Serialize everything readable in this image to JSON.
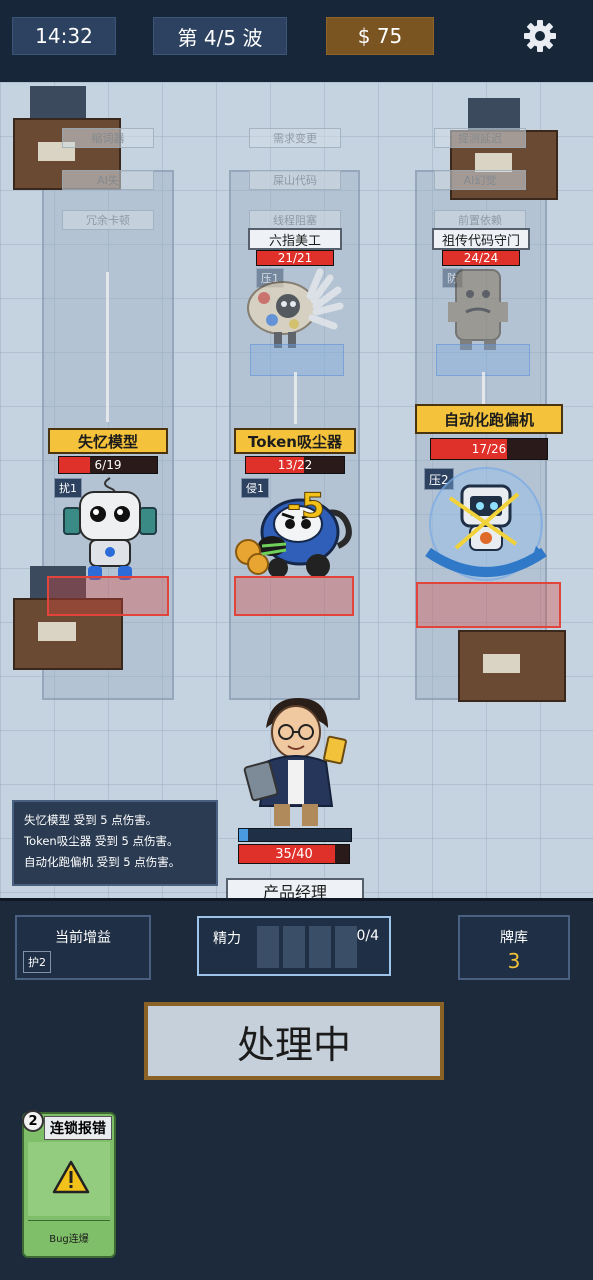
{
  "topbar": {
    "time": "14:32",
    "wave": "第 4/5 波",
    "money": "$ 75",
    "settings_icon": "gear-icon"
  },
  "field": {
    "ghost_tags": [
      "缩词器",
      "AI失",
      "冗余卡顿",
      "需求变更",
      "屎山代码",
      "线程阻塞",
      "提测延迟",
      "AI幻觉",
      "前置依赖"
    ],
    "back_enemies": [
      {
        "name": "六指美工",
        "hp": "21/21",
        "hp_current": 21,
        "hp_max": 21,
        "intent": "压1"
      },
      {
        "name": "祖传代码守门",
        "hp": "24/24",
        "hp_current": 24,
        "hp_max": 24,
        "intent": "防"
      }
    ],
    "enemies": [
      {
        "name": "失忆模型",
        "hp": "6/19",
        "hp_current": 6,
        "hp_max": 19,
        "intent": "扰1"
      },
      {
        "name": "Token吸尘器",
        "hp": "13/22",
        "hp_current": 13,
        "hp_max": 22,
        "intent": "侵1"
      },
      {
        "name": "自动化跑偏机",
        "hp": "17/26",
        "hp_current": 17,
        "hp_max": 26,
        "intent": "压2"
      }
    ],
    "damage_popup": "-5",
    "player": {
      "name": "产品经理",
      "hp": "35/40",
      "hp_current": 35,
      "hp_max": 40
    }
  },
  "log": [
    "失忆模型 受到 5 点伤害。",
    "Token吸尘器 受到 5 点伤害。",
    "自动化跑偏机 受到 5 点伤害。"
  ],
  "hud": {
    "buff_title": "当前增益",
    "buff_badge": "护2",
    "energy_label": "精力",
    "energy_value": "0/4",
    "energy_current": 0,
    "energy_max": 4,
    "deck_label": "牌库",
    "deck_count": "3",
    "process_button": "处理中"
  },
  "hand": [
    {
      "cost": "2",
      "title": "连锁报错",
      "icon": "warning-icon",
      "footer": "Bug连爆"
    }
  ],
  "colors": {
    "hp_fill": "#e0302a",
    "nameplate": "#f5c33b",
    "money_box": "#7a5521",
    "card_green": "#7fbf69"
  }
}
